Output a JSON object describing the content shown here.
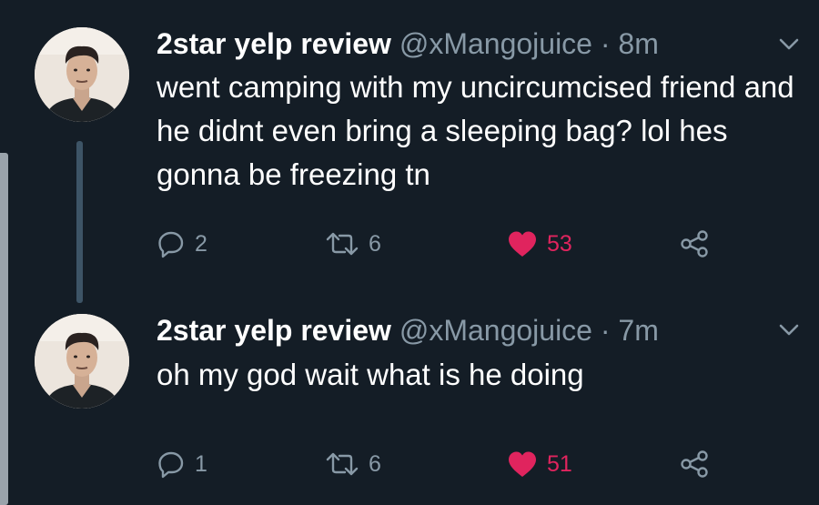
{
  "tweets": [
    {
      "author": {
        "name": "2star yelp review",
        "handle": "@xMangojuice"
      },
      "separator": "·",
      "time": "8m",
      "text": "went camping with my uncircumcised friend and he didnt even bring a sleeping bag? lol hes gonna be freezing tn",
      "counts": {
        "replies": "2",
        "retweets": "6",
        "likes": "53"
      }
    },
    {
      "author": {
        "name": "2star yelp review",
        "handle": "@xMangojuice"
      },
      "separator": "·",
      "time": "7m",
      "text": "oh my god wait what is he doing",
      "counts": {
        "replies": "1",
        "retweets": "6",
        "likes": "51"
      }
    }
  ],
  "icons": {
    "reply": "reply-icon",
    "retweet": "retweet-icon",
    "like": "heart-icon-liked",
    "share": "share-icon",
    "more": "chevron-down-icon"
  },
  "colors": {
    "background": "#141d26",
    "text": "#ffffff",
    "secondary": "#8899a6",
    "like": "#e0245e",
    "thread_line": "#3d5466"
  }
}
